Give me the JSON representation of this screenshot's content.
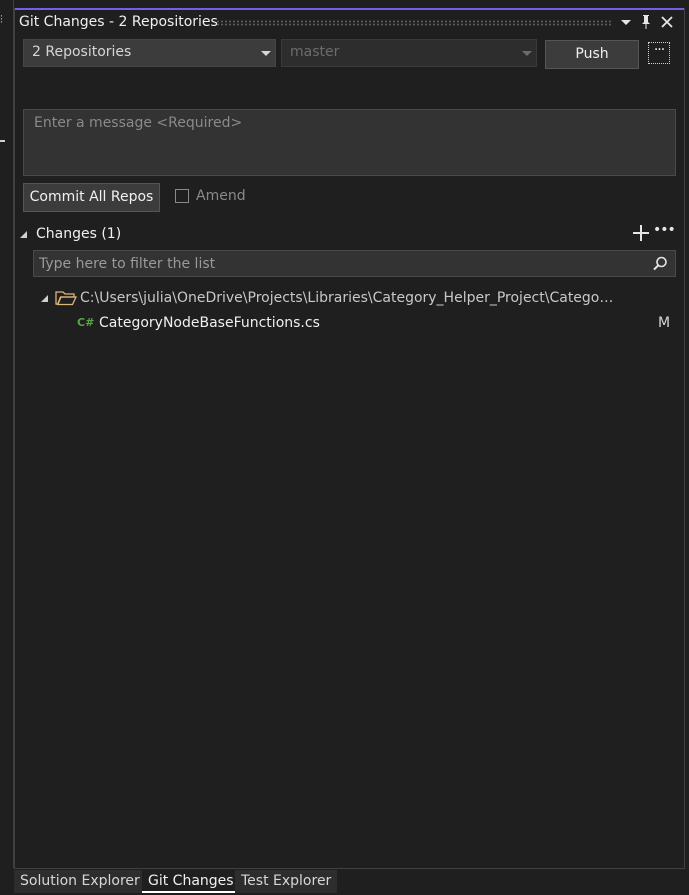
{
  "window": {
    "title": "Git Changes - 2 Repositories"
  },
  "toolbar": {
    "repo_selector": "2 Repositories",
    "branch_selector": "master",
    "push_label": "Push",
    "more_label": "···"
  },
  "commit": {
    "message_placeholder": "Enter a message <Required>",
    "message_value": "",
    "commit_button": "Commit All Repos",
    "amend_label": "Amend",
    "amend_checked": false
  },
  "changes": {
    "header": "Changes (1)",
    "filter_placeholder": "Type here to filter the list",
    "folder_path": "C:\\Users\\julia\\OneDrive\\Projects\\Libraries\\Category_Helper_Project\\Category_...",
    "files": [
      {
        "type_label": "C#",
        "name": "CategoryNodeBaseFunctions.cs",
        "status": "M"
      }
    ]
  },
  "tabs": [
    {
      "label": "Solution Explorer",
      "active": false
    },
    {
      "label": "Git Changes",
      "active": true
    },
    {
      "label": "Test Explorer",
      "active": false
    }
  ],
  "colors": {
    "accent": "#7160e8",
    "background": "#1f1f1f",
    "csharp_icon": "#57a64a",
    "folder_icon": "#dcb67a"
  }
}
